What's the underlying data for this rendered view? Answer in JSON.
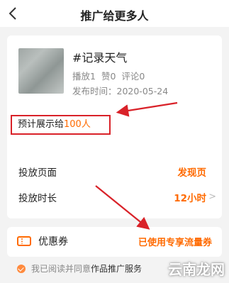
{
  "header": {
    "title": "推广给更多人",
    "back_icon": "chevron-left-icon"
  },
  "video": {
    "title": "#记录天气",
    "stats": [
      "播放1",
      "赞0",
      "评论0"
    ],
    "publish_date": "发布时间：2020-05-24"
  },
  "reach": {
    "prefix": "预计展示给",
    "count": "100人"
  },
  "settings": {
    "rows": [
      {
        "label": "投放页面",
        "value": "发现页"
      },
      {
        "label": "投放时长",
        "value": "12小时"
      }
    ]
  },
  "coupon": {
    "label": "优惠券",
    "value": "已使用专享流量券",
    "icon": "ticket-icon"
  },
  "agreement": {
    "text": "我已阅读并同意",
    "link": "作品推广服务"
  },
  "watermark": "云南龙网",
  "colors": {
    "accent": "#ff6a00",
    "highlight_border": "#d92229",
    "arrow": "#d92229"
  }
}
